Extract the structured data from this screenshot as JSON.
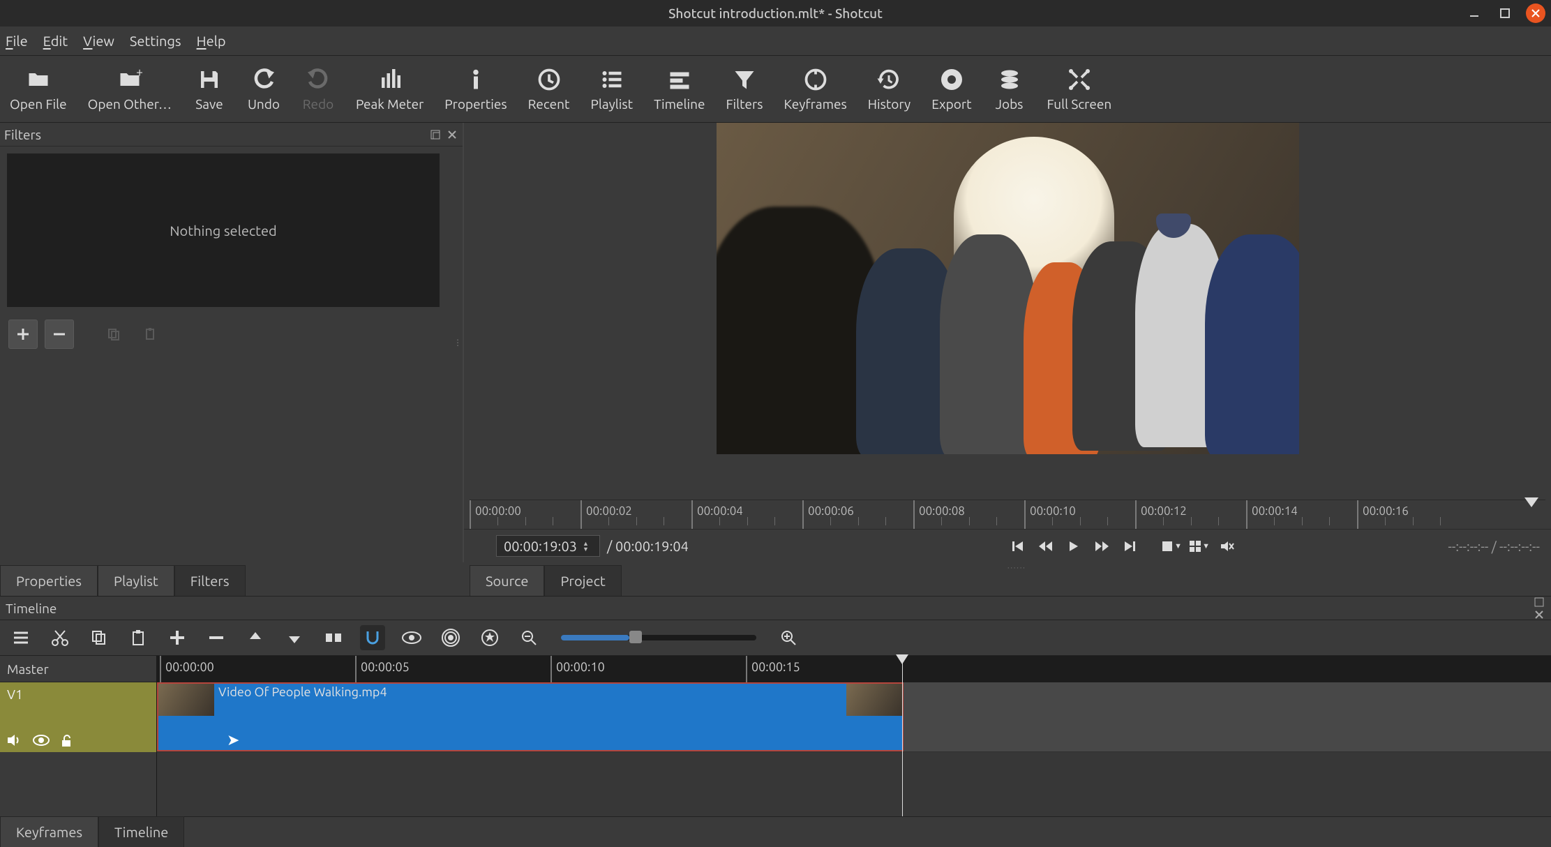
{
  "titlebar": {
    "title": "Shotcut introduction.mlt* - Shotcut"
  },
  "menubar": [
    "File",
    "Edit",
    "View",
    "Settings",
    "Help"
  ],
  "toolbar": [
    {
      "id": "open-file",
      "label": "Open File",
      "icon": "folder"
    },
    {
      "id": "open-other",
      "label": "Open Other…",
      "icon": "folder-plus"
    },
    {
      "id": "save",
      "label": "Save",
      "icon": "save"
    },
    {
      "id": "undo",
      "label": "Undo",
      "icon": "undo"
    },
    {
      "id": "redo",
      "label": "Redo",
      "icon": "redo",
      "disabled": true
    },
    {
      "id": "peak-meter",
      "label": "Peak Meter",
      "icon": "bars"
    },
    {
      "id": "properties",
      "label": "Properties",
      "icon": "info"
    },
    {
      "id": "recent",
      "label": "Recent",
      "icon": "clock"
    },
    {
      "id": "playlist",
      "label": "Playlist",
      "icon": "list"
    },
    {
      "id": "timeline",
      "label": "Timeline",
      "icon": "timeline"
    },
    {
      "id": "filters",
      "label": "Filters",
      "icon": "filter"
    },
    {
      "id": "keyframes",
      "label": "Keyframes",
      "icon": "keyframes"
    },
    {
      "id": "history",
      "label": "History",
      "icon": "history"
    },
    {
      "id": "export",
      "label": "Export",
      "icon": "disc"
    },
    {
      "id": "jobs",
      "label": "Jobs",
      "icon": "stack"
    },
    {
      "id": "full-screen",
      "label": "Full Screen",
      "icon": "fullscreen"
    }
  ],
  "filters_panel": {
    "title": "Filters",
    "empty": "Nothing selected"
  },
  "preview_ruler": [
    "00:00:00",
    "00:00:02",
    "00:00:04",
    "00:00:06",
    "00:00:08",
    "00:00:10",
    "00:00:12",
    "00:00:14",
    "00:00:16"
  ],
  "playbar": {
    "current": "00:00:19:03",
    "total": "/ 00:00:19:04",
    "dashes": "--:--:--:-- / --:--:--:--"
  },
  "left_tabs": [
    "Properties",
    "Playlist",
    "Filters"
  ],
  "right_tabs": [
    "Source",
    "Project"
  ],
  "timeline_title": "Timeline",
  "timeline_ruler": [
    "00:00:00",
    "00:00:05",
    "00:00:10",
    "00:00:15"
  ],
  "tracks": {
    "master": "Master",
    "v1": "V1"
  },
  "clip": {
    "label": "Video Of People Walking.mp4"
  },
  "bottom_tabs": [
    "Keyframes",
    "Timeline"
  ]
}
